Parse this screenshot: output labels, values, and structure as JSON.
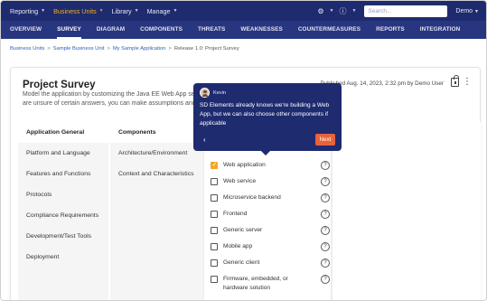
{
  "topnav": {
    "items": [
      {
        "label": "Reporting",
        "active": false
      },
      {
        "label": "Business Units",
        "active": true
      },
      {
        "label": "Library",
        "active": false
      },
      {
        "label": "Manage",
        "active": false
      }
    ],
    "search_placeholder": "Search...",
    "user": "Demo",
    "settings_icon": "gear-icon",
    "help_icon": "help-icon"
  },
  "subnav": {
    "tabs": [
      {
        "label": "OVERVIEW",
        "active": false
      },
      {
        "label": "SURVEY",
        "active": true
      },
      {
        "label": "DIAGRAM",
        "active": false
      },
      {
        "label": "COMPONENTS",
        "active": false
      },
      {
        "label": "THREATS",
        "active": false
      },
      {
        "label": "WEAKNESSES",
        "active": false
      },
      {
        "label": "COUNTERMEASURES",
        "active": false
      },
      {
        "label": "REPORTS",
        "active": false
      },
      {
        "label": "INTEGRATION",
        "active": false
      }
    ]
  },
  "breadcrumb": {
    "items": [
      "Business Units",
      "Sample Business Unit",
      "My Sample Application"
    ],
    "current": "Release 1.0: Project Survey"
  },
  "page": {
    "title": "Project Survey",
    "description_line1": "Model the application by customizing the Java EE Web App setti",
    "description_line2": "are unsure of certain answers, you can make assumptions and th",
    "published": "Published Aug. 14, 2023, 2:32 pm by Demo User"
  },
  "sections": {
    "items": [
      {
        "label": "Application General",
        "active": true
      },
      {
        "label": "Platform and Language",
        "active": false
      },
      {
        "label": "Features and Functions",
        "active": false
      },
      {
        "label": "Protocols",
        "active": false
      },
      {
        "label": "Compliance Requirements",
        "active": false
      },
      {
        "label": "Development/Test Tools",
        "active": false
      },
      {
        "label": "Deployment",
        "active": false
      }
    ]
  },
  "subsections": {
    "items": [
      {
        "label": "Components",
        "active": true
      },
      {
        "label": "Architecture/Environment",
        "active": false
      },
      {
        "label": "Context and Characteristics",
        "active": false
      }
    ]
  },
  "options": {
    "help_symbol": "?",
    "items": [
      {
        "label": "Web application",
        "checked": true
      },
      {
        "label": "Web service",
        "checked": false
      },
      {
        "label": "Microservice backend",
        "checked": false
      },
      {
        "label": "Frontend",
        "checked": false
      },
      {
        "label": "Generic server",
        "checked": false
      },
      {
        "label": "Mobile app",
        "checked": false
      },
      {
        "label": "Generic client",
        "checked": false
      },
      {
        "label": "Firmware, embedded, or hardware solution",
        "checked": false
      }
    ]
  },
  "tooltip": {
    "name": "Kevin",
    "message": "SD Elements already knows we're building a Web App, but we can also choose other components if applicable",
    "back": "‹",
    "next": "Next"
  },
  "colors": {
    "nav_bg": "#1f2b6f",
    "subnav_bg": "#28367f",
    "accent": "#f5b400",
    "checkbox": "#f5a623",
    "next_button": "#e8623c"
  }
}
